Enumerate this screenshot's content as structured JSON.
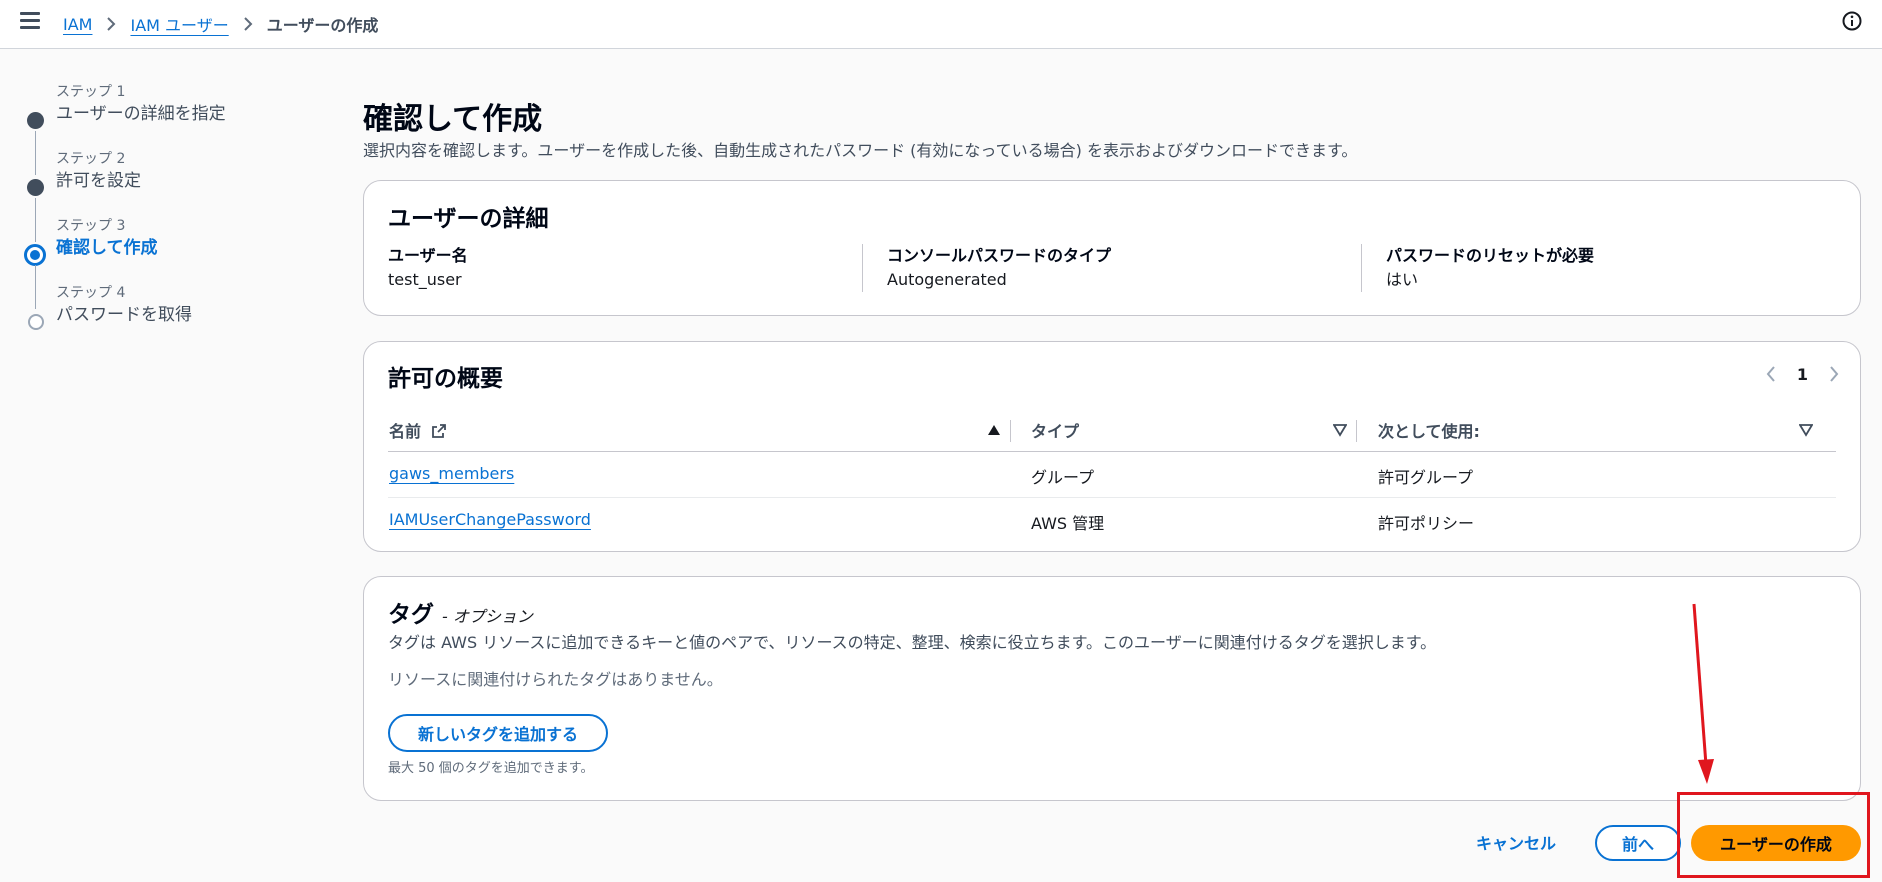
{
  "breadcrumb": {
    "items": [
      "IAM",
      "IAM ユーザー"
    ],
    "current": "ユーザーの作成"
  },
  "steps": [
    {
      "num": "ステップ 1",
      "title": "ユーザーの詳細を指定"
    },
    {
      "num": "ステップ 2",
      "title": "許可を設定"
    },
    {
      "num": "ステップ 3",
      "title": "確認して作成"
    },
    {
      "num": "ステップ 4",
      "title": "パスワードを取得"
    }
  ],
  "page": {
    "title": "確認して作成",
    "description": "選択内容を確認します。ユーザーを作成した後、自動生成されたパスワード (有効になっている場合) を表示およびダウンロードできます。"
  },
  "user_details": {
    "title": "ユーザーの詳細",
    "fields": [
      {
        "label": "ユーザー名",
        "value": "test_user"
      },
      {
        "label": "コンソールパスワードのタイプ",
        "value": "Autogenerated"
      },
      {
        "label": "パスワードのリセットが必要",
        "value": "はい"
      }
    ]
  },
  "permissions": {
    "title": "許可の概要",
    "page": "1",
    "columns": [
      "名前",
      "タイプ",
      "次として使用:"
    ],
    "rows": [
      {
        "name": "gaws_members",
        "type": "グループ",
        "used_as": "許可グループ"
      },
      {
        "name": "IAMUserChangePassword",
        "type": "AWS 管理",
        "used_as": "許可ポリシー"
      }
    ]
  },
  "tags": {
    "title": "タグ",
    "optional": "- オプション",
    "description": "タグは AWS リソースに追加できるキーと値のペアで、リソースの特定、整理、検索に役立ちます。このユーザーに関連付けるタグを選択します。",
    "empty": "リソースに関連付けられたタグはありません。",
    "add_button": "新しいタグを追加する",
    "hint": "最大 50 個のタグを追加できます。"
  },
  "footer": {
    "cancel": "キャンセル",
    "previous": "前へ",
    "create": "ユーザーの作成"
  },
  "colors": {
    "link": "#0972d3",
    "primary_button": "#ff9900",
    "annotation": "#e0161e"
  }
}
